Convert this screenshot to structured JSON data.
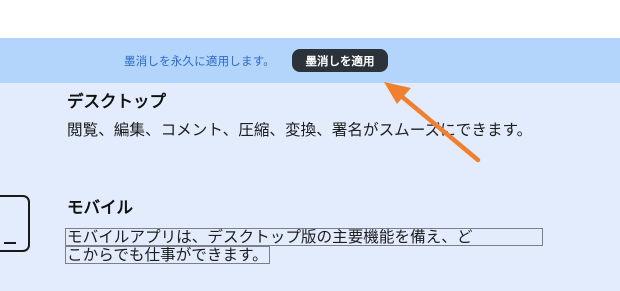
{
  "redaction_bar": {
    "message": "墨消しを永久に適用します。",
    "apply_button": "墨消しを適用",
    "background": "#b3d5fb",
    "button_color": "#2b3239"
  },
  "sections": {
    "desktop": {
      "title": "デスクトップ",
      "description": "閲覧、編集、コメント、圧縮、変換、署名がスムーズにできます。"
    },
    "mobile": {
      "title": "モバイル",
      "description_line1": "モバイルアプリは、デスクトップ版の主要機能を備え、ど",
      "description_line2": "こからでも仕事ができます。",
      "icon": "smartphone-icon"
    }
  },
  "annotation": {
    "arrow_color": "#f08030",
    "icon": "arrow-pointer-icon"
  }
}
